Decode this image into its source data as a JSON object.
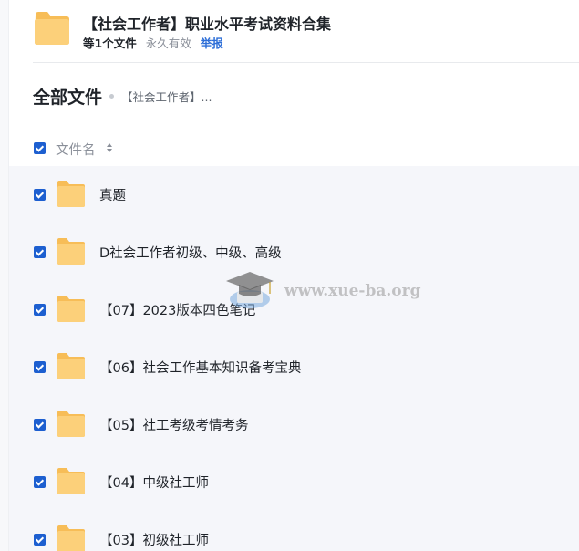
{
  "share": {
    "title": "【社会工作者】职业水平考试资料合集",
    "file_count": "等1个文件",
    "validity": "永久有效",
    "report_label": "举报"
  },
  "breadcrumb": {
    "root": "全部文件",
    "current": "【社会工作者】..."
  },
  "list": {
    "column_name": "文件名",
    "items": [
      {
        "name": "真题"
      },
      {
        "name": "D社会工作者初级、中级、高级"
      },
      {
        "name": "【07】2023版本四色笔记"
      },
      {
        "name": "【06】社会工作基本知识备考宝典"
      },
      {
        "name": "【05】社工考级考情考务"
      },
      {
        "name": "【04】中级社工师"
      },
      {
        "name": "【03】初级社工师"
      }
    ]
  },
  "watermark": {
    "text": "www.xue-ba.org"
  },
  "colors": {
    "folder": "#fcd07a",
    "folder_tab": "#f7bd57",
    "checkbox": "#1d5fd0",
    "link": "#2e6fd8",
    "list_bg": "#f5f6fa"
  }
}
